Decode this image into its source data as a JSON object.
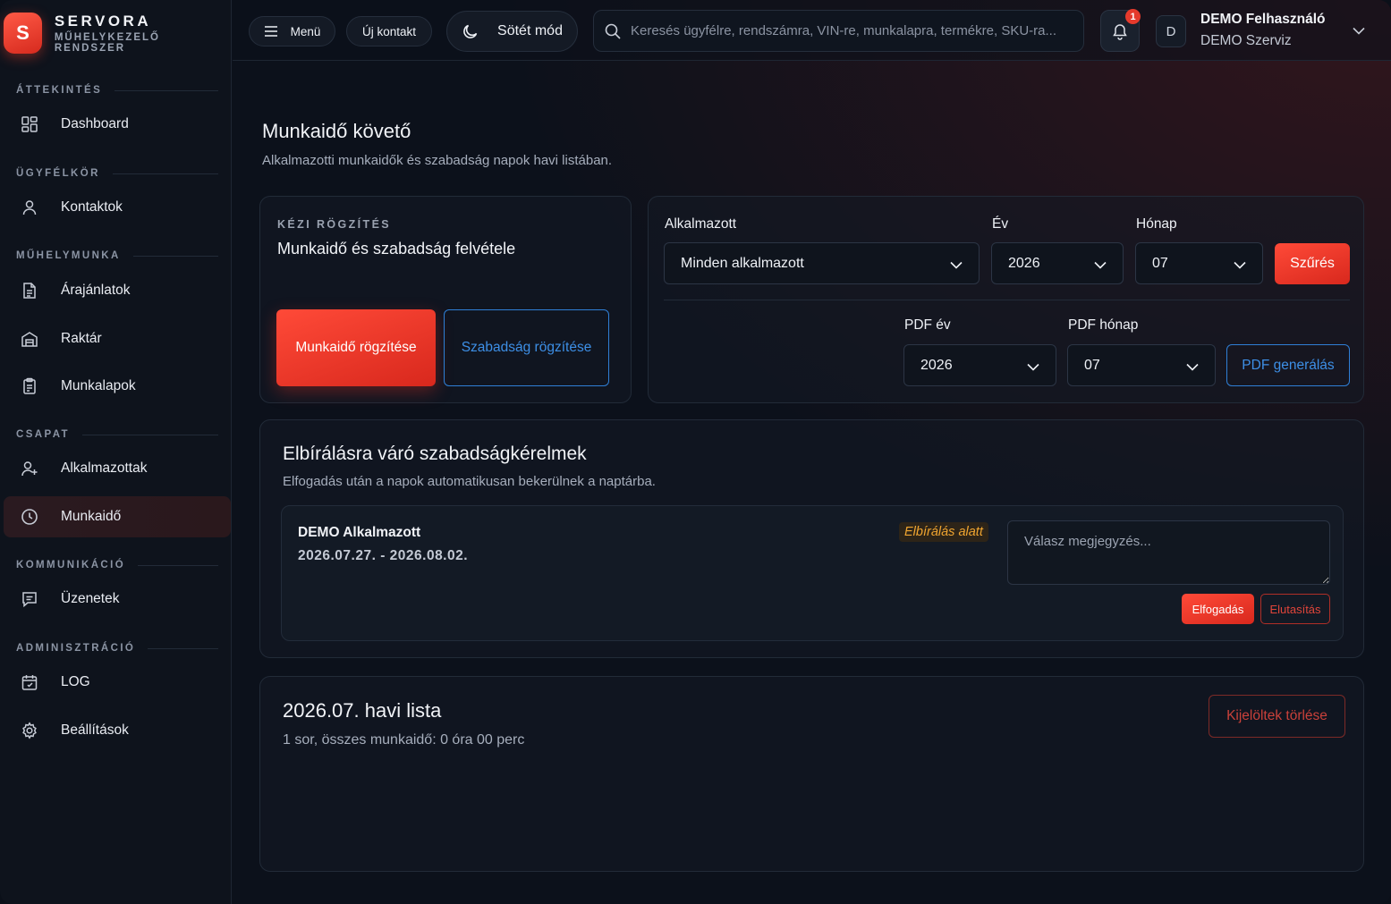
{
  "brand": {
    "logo_letter": "S",
    "name": "SERVORA",
    "subtitle": "MŰHELYKEZELŐ RENDSZER"
  },
  "sidebar": {
    "sections": [
      {
        "title": "ÁTTEKINTÉS"
      },
      {
        "title": "ÜGYFÉLKÖR"
      },
      {
        "title": "MŰHELYMUNKA"
      },
      {
        "title": "CSAPAT"
      },
      {
        "title": "KOMMUNIKÁCIÓ"
      },
      {
        "title": "ADMINISZTRÁCIÓ"
      }
    ],
    "items": [
      {
        "label": "Dashboard",
        "icon": "dashboard-icon"
      },
      {
        "label": "Kontaktok",
        "icon": "user-icon"
      },
      {
        "label": "Árajánlatok",
        "icon": "document-icon"
      },
      {
        "label": "Raktár",
        "icon": "warehouse-icon"
      },
      {
        "label": "Munkalapok",
        "icon": "clipboard-icon"
      },
      {
        "label": "Alkalmazottak",
        "icon": "user-plus-icon"
      },
      {
        "label": "Munkaidő",
        "icon": "clock-icon",
        "active": true
      },
      {
        "label": "Üzenetek",
        "icon": "message-icon"
      },
      {
        "label": "LOG",
        "icon": "calendar-icon"
      },
      {
        "label": "Beállítások",
        "icon": "gear-icon"
      }
    ]
  },
  "topbar": {
    "menu_label": "Menü",
    "new_contact_label": "Új kontakt",
    "dark_mode_label": "Sötét mód",
    "search_placeholder": "Keresés ügyfélre, rendszámra, VIN-re, munkalapra, termékre, SKU-ra...",
    "notification_count": "1",
    "avatar_letter": "D",
    "user_name": "DEMO Felhasználó",
    "user_org": "DEMO Szerviz"
  },
  "page": {
    "title": "Munkaidő követő",
    "subtitle": "Alkalmazotti munkaidők és szabadság napok havi listában."
  },
  "manual_entry": {
    "eyebrow": "KÉZI RÖGZÍTÉS",
    "title": "Munkaidő és szabadság felvétele",
    "work_button": "Munkaidő rögzítése",
    "leave_button": "Szabadság rögzítése"
  },
  "filters": {
    "employee_label": "Alkalmazott",
    "employee_value": "Minden alkalmazott",
    "year_label": "Év",
    "year_value": "2026",
    "month_label": "Hónap",
    "month_value": "07",
    "filter_button": "Szűrés",
    "pdf_year_label": "PDF év",
    "pdf_year_value": "2026",
    "pdf_month_label": "PDF hónap",
    "pdf_month_value": "07",
    "pdf_button": "PDF generálás"
  },
  "requests": {
    "title": "Elbírálásra váró szabadságkérelmek",
    "subtitle": "Elfogadás után a napok automatikusan bekerülnek a naptárba.",
    "items": [
      {
        "employee": "DEMO Alkalmazott",
        "range": "2026.07.27. - 2026.08.02.",
        "status": "Elbírálás alatt",
        "reply_placeholder": "Válasz megjegyzés...",
        "accept_label": "Elfogadás",
        "reject_label": "Elutasítás"
      }
    ]
  },
  "monthly": {
    "title": "2026.07. havi lista",
    "summary": "1 sor, összes munkaidő: 0 óra 00 perc",
    "delete_button": "Kijelöltek törlése"
  },
  "colors": {
    "accent": "#e8362a",
    "blue": "#2f7fd6",
    "warning": "#f0a530",
    "bg": "#0c111b"
  }
}
